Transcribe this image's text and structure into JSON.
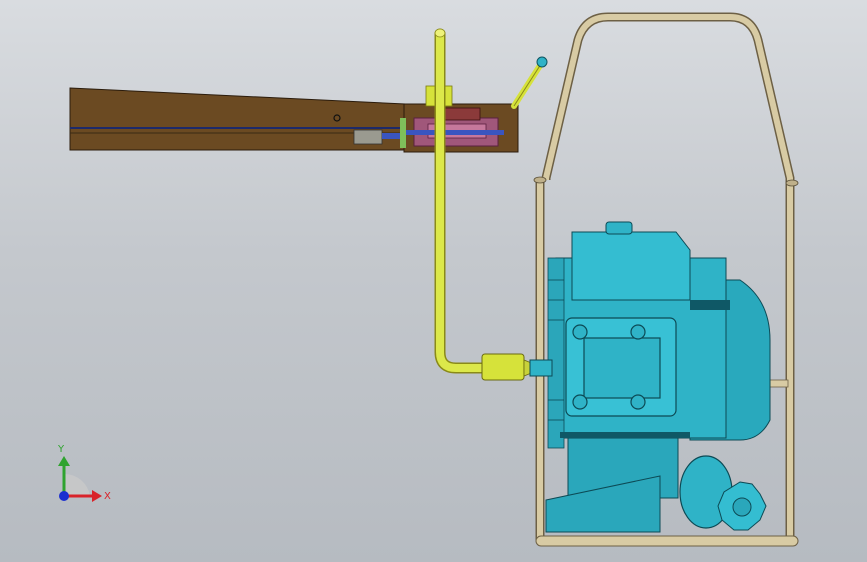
{
  "viewport": {
    "background_top": "#d9dce0",
    "background_bottom": "#b6bbc1"
  },
  "model": {
    "frame_color": "#c9b98f",
    "engine_color": "#2fb3c7",
    "lever_color": "#d6e23a",
    "handle_color": "#6b4a22",
    "clamp_color": "#a0577a"
  },
  "triad": {
    "x_label": "X",
    "y_label": "Y",
    "x_color": "#d9232a",
    "y_color": "#2fa32f",
    "z_color": "#1b2fd0"
  }
}
